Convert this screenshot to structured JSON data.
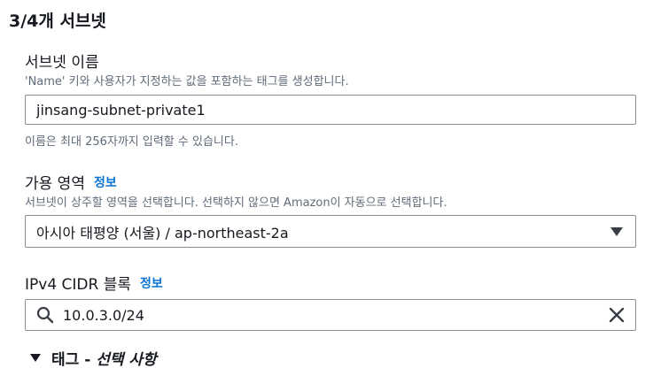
{
  "section": {
    "title": "3/4개 서브넷"
  },
  "subnet_name": {
    "label": "서브넷 이름",
    "description": "'Name' 키와 사용자가 지정하는 값을 포함하는 태그를 생성합니다.",
    "value": "jinsang-subnet-private1",
    "hint": "이름은 최대 256자까지 입력할 수 있습니다."
  },
  "availability_zone": {
    "label": "가용 영역",
    "info_link": "정보",
    "description": "서브넷이 상주할 영역을 선택합니다. 선택하지 않으면 Amazon이 자동으로 선택합니다.",
    "selected": "아시아 태평양 (서울) / ap-northeast-2a"
  },
  "cidr": {
    "label": "IPv4 CIDR 블록",
    "info_link": "정보",
    "value": "10.0.3.0/24"
  },
  "tags": {
    "label": "태그 - ",
    "optional": "선택 사항"
  },
  "icons": {
    "search": "search-icon",
    "clear": "close-icon",
    "dropdown": "caret-down-icon",
    "expand": "caret-down-icon"
  }
}
